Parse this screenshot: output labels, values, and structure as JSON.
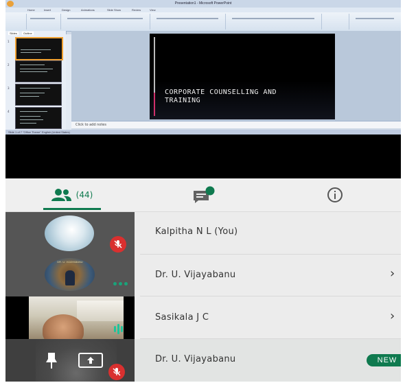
{
  "window": {
    "title": "Presentation1 - Microsoft PowerPoint"
  },
  "ppt": {
    "ribbon_tabs": [
      "Home",
      "Insert",
      "Design",
      "Animations",
      "Slide Show",
      "Review",
      "View"
    ],
    "pane_tabs": [
      "Slides",
      "Outline"
    ],
    "slide_title_line1": "CORPORATE COUNSELLING AND",
    "slide_title_line2": "TRAINING",
    "notes_placeholder": "Click to add notes",
    "status": "Slide 1 of 7   \"Office Theme\"   English (United States)"
  },
  "tabs": {
    "people_count": "(44)",
    "chat_badge": "2"
  },
  "participants": [
    {
      "name": "Kalpitha N L (You)",
      "muted": true
    },
    {
      "name": "Dr. U. Vijayabanu",
      "avatar_text": "DR. U. VIJAYABANU"
    },
    {
      "name": "Sasikala J C",
      "speaking": true
    },
    {
      "name": "Dr. U. Vijayabanu",
      "badge": "NEW",
      "muted": true
    }
  ],
  "colors": {
    "accent_green": "#0f7a4f",
    "mute_red": "#d9302f"
  }
}
